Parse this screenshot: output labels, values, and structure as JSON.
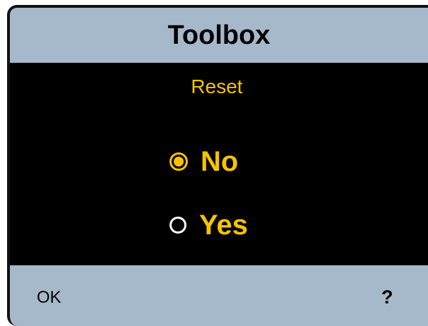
{
  "window": {
    "title": "Toolbox"
  },
  "main": {
    "subtitle": "Reset",
    "options": [
      {
        "label": "No",
        "selected": true
      },
      {
        "label": "Yes",
        "selected": false
      }
    ]
  },
  "footer": {
    "left_softkey": "OK",
    "right_softkey": "?"
  },
  "colors": {
    "bar_background": "#a6b9cb",
    "screen_background": "#000000",
    "accent": "#f5c400"
  }
}
